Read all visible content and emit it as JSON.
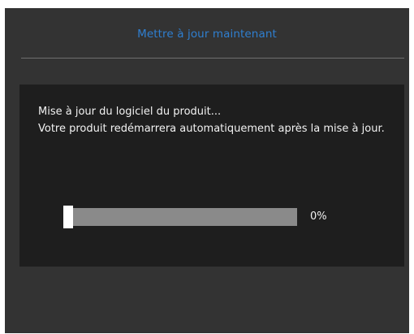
{
  "dialog": {
    "title": "Mettre à jour maintenant",
    "message_line1": "Mise à jour du logiciel du produit...",
    "message_line2": "Votre produit redémarrera automatiquement après la mise à jour.",
    "progress": {
      "value_percent": 0,
      "label": "0%"
    },
    "colors": {
      "background": "#333333",
      "panel": "#1e1e1e",
      "title": "#2f7fd0",
      "track": "#8a8a8a",
      "handle": "#ffffff"
    }
  }
}
